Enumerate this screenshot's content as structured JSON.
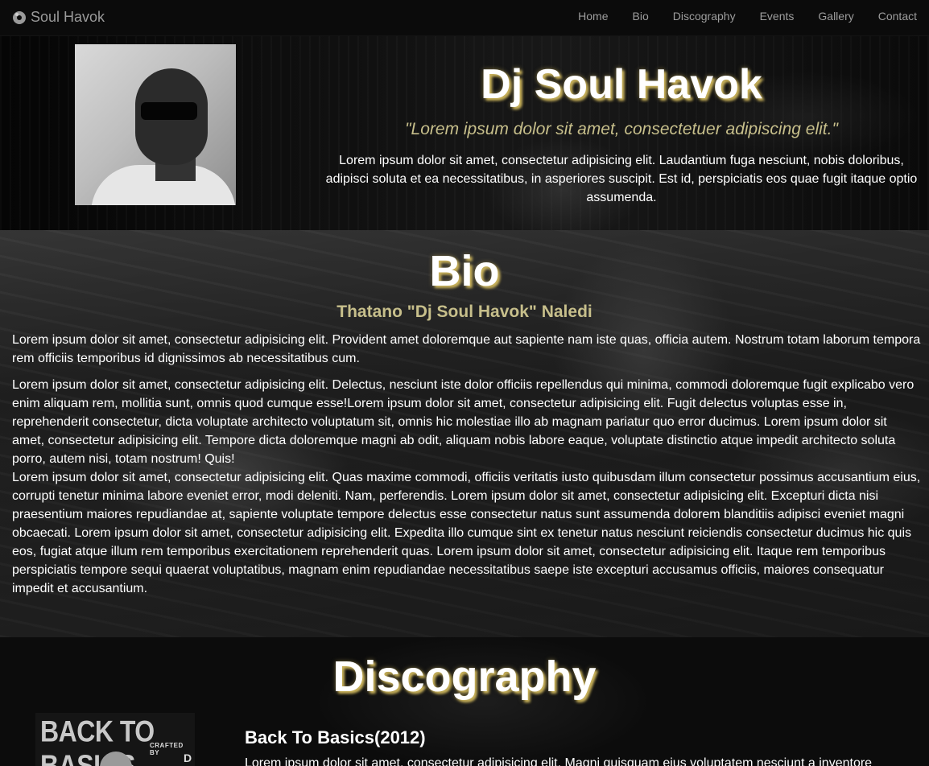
{
  "brand": {
    "label": "Soul Havok",
    "icon": "vinyl-disc-icon"
  },
  "nav": {
    "items": [
      "Home",
      "Bio",
      "Discography",
      "Events",
      "Gallery",
      "Contact"
    ]
  },
  "hero": {
    "title": "Dj Soul Havok",
    "quote": "\"Lorem ipsum dolor sit amet, consectetuer adipiscing elit.\"",
    "text": "Lorem ipsum dolor sit amet, consectetur adipisicing elit. Laudantium fuga nesciunt, nobis doloribus, adipisci soluta et ea necessitatibus, in asperiores suscipit. Est id, perspiciatis eos quae fugit itaque optio assumenda."
  },
  "bio": {
    "title": "Bio",
    "subtitle": "Thatano \"Dj Soul Havok\" Naledi",
    "paragraph1": "Lorem ipsum dolor sit amet, consectetur adipisicing elit. Provident amet doloremque aut sapiente nam iste quas, officia autem. Nostrum totam laborum tempora rem officiis temporibus id dignissimos ab necessitatibus cum.",
    "paragraph2a": "Lorem ipsum dolor sit amet, consectetur adipisicing elit. Delectus, nesciunt iste dolor officiis repellendus qui minima, commodi doloremque fugit explicabo vero enim aliquam rem, mollitia sunt, omnis quod cumque esse!Lorem ipsum dolor sit amet, consectetur adipisicing elit. Fugit delectus voluptas esse in, reprehenderit consectetur, dicta voluptate architecto voluptatum sit, omnis hic molestiae illo ab magnam pariatur quo error ducimus. Lorem ipsum dolor sit amet, consectetur adipisicing elit. Tempore dicta doloremque magni ab odit, aliquam nobis labore eaque, voluptate distinctio atque impedit architecto soluta porro, autem nisi, totam nostrum! Quis!",
    "paragraph2b": "Lorem ipsum dolor sit amet, consectetur adipisicing elit. Quas maxime commodi, officiis veritatis iusto quibusdam illum consectetur possimus accusantium eius, corrupti tenetur minima labore eveniet error, modi deleniti. Nam, perferendis. Lorem ipsum dolor sit amet, consectetur adipisicing elit. Excepturi dicta nisi praesentium maiores repudiandae at, sapiente voluptate tempore delectus esse consectetur natus sunt assumenda dolorem blanditiis adipisci eveniet magni obcaecati. Lorem ipsum dolor sit amet, consectetur adipisicing elit. Expedita illo cumque sint ex tenetur natus nesciunt reiciendis consectetur ducimus hic quis eos, fugiat atque illum rem temporibus exercitationem reprehenderit quas. Lorem ipsum dolor sit amet, consectetur adipisicing elit. Itaque rem temporibus perspiciatis tempore sequi quaerat voluptatibus, magnam enim repudiandae necessitatibus saepe iste excepturi accusamus officiis, maiores consequatur impedit et accusantium."
  },
  "discography": {
    "title": "Discography",
    "album": {
      "cover_title": "BACK TO BASICS",
      "cover_subtitle": "CRAFTED BY",
      "cover_letter": "D",
      "title": "Back To Basics(2012)",
      "text": "Lorem ipsum dolor sit amet, consectetur adipisicing elit. Magni quisquam eius voluptatem nesciunt a inventore"
    }
  },
  "colors": {
    "accent": "#c9b25a",
    "subtitle": "#c7bf8b",
    "nav_text": "#9d9d9d",
    "navbar_bg": "#0b0b0b"
  }
}
